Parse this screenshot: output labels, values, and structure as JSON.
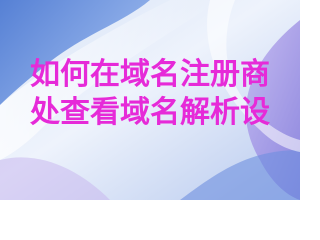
{
  "title": {
    "line1": "如何在域名注册商",
    "line2": "处查看域名解析设"
  },
  "colors": {
    "title_text": "#e62ad8",
    "background_light": "#e7eefb",
    "background_blue": "#5b84d6",
    "background_purple": "#9e8ee4"
  }
}
